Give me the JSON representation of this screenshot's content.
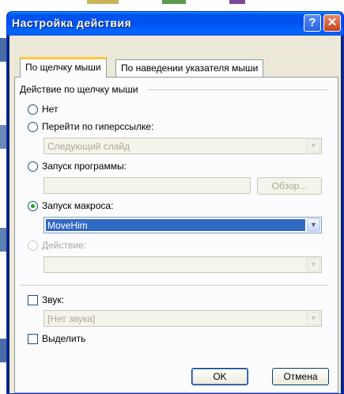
{
  "window": {
    "title": "Настройка действия",
    "help_glyph": "?",
    "close_glyph": "✕"
  },
  "tabs": [
    {
      "label": "По щелчку мыши",
      "active": true
    },
    {
      "label": "По наведении указателя мыши",
      "active": false
    }
  ],
  "group": {
    "label": "Действие по щелчку мыши"
  },
  "options": {
    "none": {
      "label": "Нет",
      "checked": false
    },
    "hyperlink": {
      "label": "Перейти по гиперссылке:",
      "checked": false,
      "value": "Следующий слайд"
    },
    "program": {
      "label": "Запуск программы:",
      "checked": false,
      "value": "",
      "browse_label": "Обзор..."
    },
    "macro": {
      "label": "Запуск макроса:",
      "checked": true,
      "value": "MoveHim"
    },
    "action": {
      "label": "Действие:",
      "checked": false,
      "disabled": true,
      "value": ""
    }
  },
  "sound": {
    "label": "Звук:",
    "checked": false,
    "value": "[Нет звука]"
  },
  "highlight": {
    "label": "Выделить",
    "checked": false
  },
  "buttons": {
    "ok": "OK",
    "cancel": "Отмена"
  },
  "colors": {
    "title_bar": "#0054e3",
    "dialog_bg": "#ece9d8",
    "selection": "#316ac5",
    "radio_dot": "#21a121"
  },
  "icons": {
    "dropdown": "chevron-down-icon",
    "help": "help-icon",
    "close": "close-icon"
  }
}
